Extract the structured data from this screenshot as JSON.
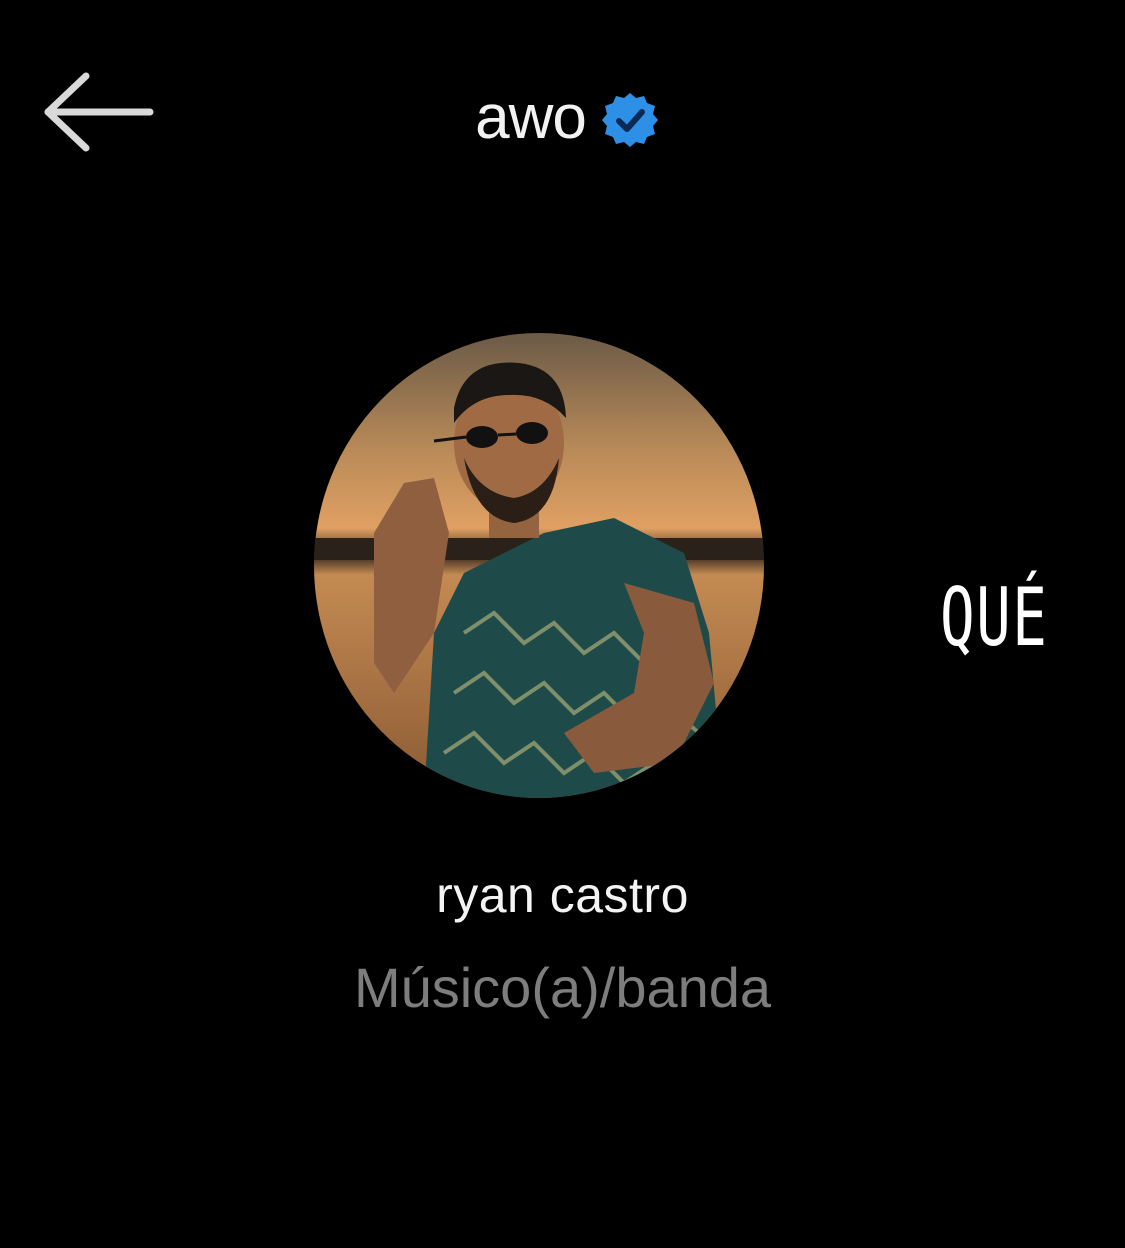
{
  "header": {
    "username": "awo",
    "back_icon": "arrow-left-icon",
    "verified_icon": "verified-badge-icon",
    "verified_color": "#2e8fe6"
  },
  "profile": {
    "display_name": "ryan castro",
    "category": "Músico(a)/banda",
    "avatar_icon": "profile-photo"
  },
  "overlay": {
    "text": "QUÉ"
  },
  "colors": {
    "background": "#000000",
    "primary_text": "#f2f2f2",
    "secondary_text": "#7d7d7d"
  }
}
